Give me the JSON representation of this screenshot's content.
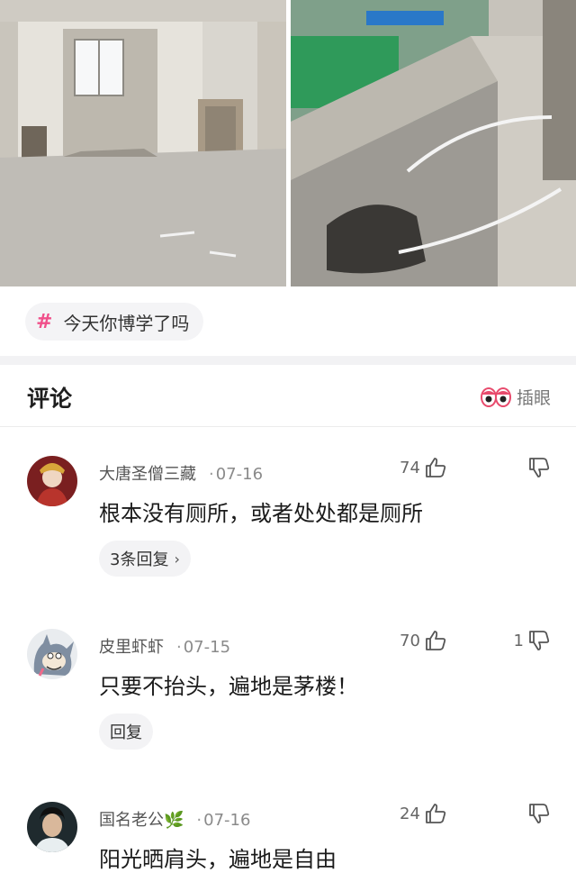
{
  "topic": {
    "label": "今天你博学了吗"
  },
  "comments_header": {
    "title": "评论",
    "insert_eye_label": "插眼"
  },
  "comments": [
    {
      "user": "大唐圣僧三藏",
      "date": "07-16",
      "likes": "74",
      "dislikes": "",
      "text": "根本没有厕所，或者处处都是厕所",
      "reply_label": "3条回复",
      "reply_chevron": "›"
    },
    {
      "user": "皮里虾虾",
      "date": "07-15",
      "likes": "70",
      "dislikes": "1",
      "text": "只要不抬头，遍地是茅楼！",
      "reply_label": "回复",
      "reply_chevron": ""
    },
    {
      "user": "国名老公🌿",
      "date": "07-16",
      "likes": "24",
      "dislikes": "",
      "text": "阳光晒肩头，遍地是自由",
      "reply_label": "",
      "reply_chevron": ""
    }
  ],
  "separator_dot": "·",
  "colors": {
    "accent": "#f0508a",
    "text": "#1b1b1b",
    "muted": "#8a8a8a",
    "pill": "#f3f3f5"
  }
}
